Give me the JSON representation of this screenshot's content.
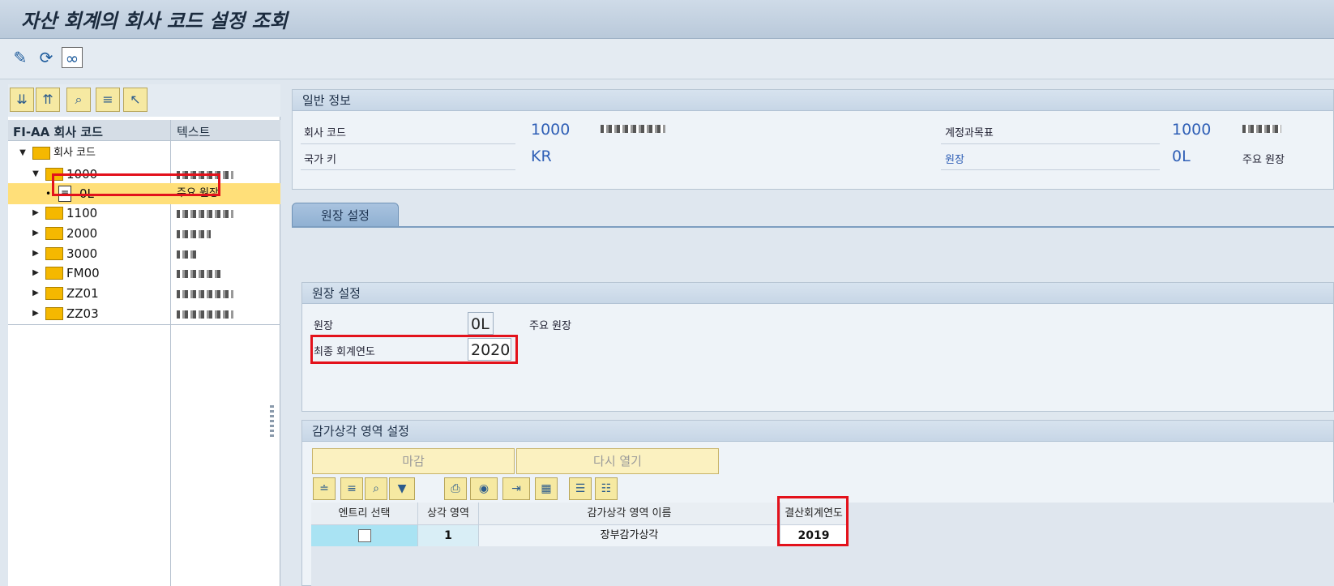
{
  "window": {
    "title": "자산 회계의 회사 코드 설정 조회"
  },
  "toolbar": {
    "icons": [
      "pencil-icon",
      "refresh-icon",
      "glasses-icon"
    ]
  },
  "tree": {
    "tools": [
      "expand-all-icon",
      "collapse-all-icon",
      "find-icon",
      "hierarchy-icon",
      "select-icon"
    ],
    "header_code": "FI-AA 회사 코드",
    "header_text": "텍스트",
    "root_label": "회사 코드",
    "nodes": [
      {
        "code": "1000",
        "expanded": true
      },
      {
        "code": "0L",
        "text": "주요 원장",
        "selected": true
      },
      {
        "code": "1100"
      },
      {
        "code": "2000"
      },
      {
        "code": "3000"
      },
      {
        "code": "FM00"
      },
      {
        "code": "ZZ01"
      },
      {
        "code": "ZZ03"
      }
    ]
  },
  "general": {
    "title": "일반 정보",
    "company_code_label": "회사 코드",
    "company_code": "1000",
    "country_label": "국가 키",
    "country": "KR",
    "coa_label": "계정과목표",
    "coa": "1000",
    "ledger_label": "원장",
    "ledger": "0L",
    "ledger_text": "주요 원장"
  },
  "tab": {
    "label": "원장 설정"
  },
  "ledger_settings": {
    "title": "원장 설정",
    "ledger_label": "원장",
    "ledger_value": "0L",
    "ledger_text": "주요 원장",
    "last_fy_label": "최종 회계연도",
    "last_fy_value": "2020"
  },
  "depr_area": {
    "title": "감가상각 영역 설정",
    "close_btn": "마감",
    "reopen_btn": "다시 열기",
    "columns": [
      "엔트리 선택",
      "상각 영역",
      "감가상각 영역 이름",
      "결산회계연도"
    ],
    "rows": [
      {
        "area": "1",
        "name": "장부감가상각",
        "fy": "2019"
      }
    ]
  }
}
